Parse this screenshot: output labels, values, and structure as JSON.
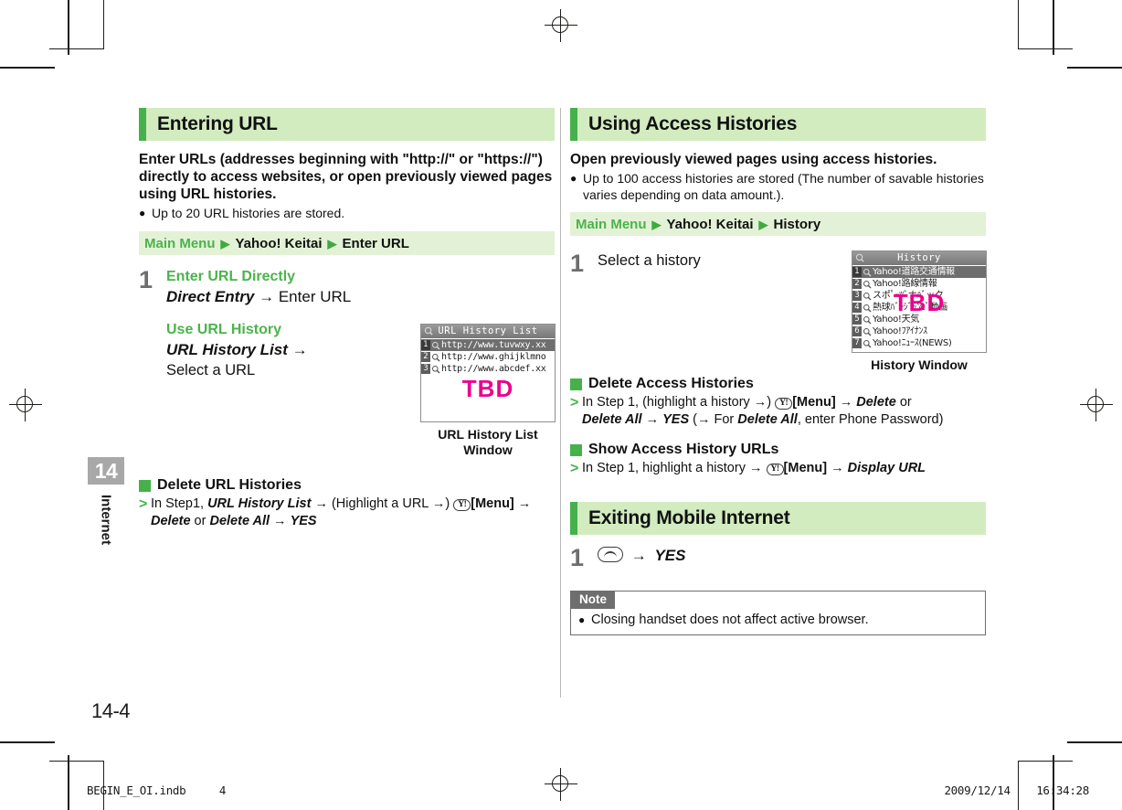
{
  "page": {
    "number": "14-4",
    "chapter_number": "14",
    "chapter_name": "Internet"
  },
  "footer": {
    "file": "BEGIN_E_OI.indb",
    "sheet": "4",
    "date": "2009/12/14",
    "time": "16:34:28"
  },
  "colors": {
    "accent_green": "#46b14b",
    "head_bg": "#d2ecc0",
    "path_bg": "#e3f2d6",
    "tbd_magenta": "#ec008c",
    "gray": "#6e6e6e"
  },
  "left": {
    "section": {
      "title": "Entering URL"
    },
    "intro": "Enter URLs (addresses beginning with \"http://\" or \"https://\") directly to access websites, or open previously viewed pages using URL histories.",
    "bullet": "Up to 20 URL histories are stored.",
    "menu_path": {
      "root": "Main Menu",
      "items": [
        "Yahoo! Keitai",
        "Enter URL"
      ],
      "arrow": "▶"
    },
    "step": {
      "number": "1",
      "block1": {
        "heading": "Enter URL Directly",
        "action_bold": "Direct Entry",
        "arrow": "→",
        "action_rest": "Enter URL"
      },
      "block2": {
        "heading": "Use URL History",
        "action_bold": "URL History List",
        "arrow": "→",
        "action_rest": "Select a URL"
      }
    },
    "screenshot": {
      "title": "URL History List",
      "caption": "URL History List Window",
      "tbd": "TBD",
      "rows": [
        {
          "index": "1",
          "label": "http://www.tuvwxy.xx",
          "selected": true
        },
        {
          "index": "2",
          "label": "http://www.ghijklmno",
          "selected": false
        },
        {
          "index": "3",
          "label": "http://www.abcdef.xx",
          "selected": false
        }
      ]
    },
    "subsection": {
      "heading": "Delete URL Histories",
      "marker": ">",
      "line1_pre": "In Step1, ",
      "line1_bi1": "URL History List",
      "line1_mid": " → (Highlight a URL →) ",
      "key_label": "Y!",
      "line1_menu": "[Menu]",
      "line1_post": " →",
      "line2_bi1": "Delete",
      "line2_or": " or ",
      "line2_bi2": "Delete All",
      "line2_arrow": " → ",
      "line2_bi3": "YES"
    }
  },
  "right": {
    "section": {
      "title": "Using Access Histories"
    },
    "intro": "Open previously viewed pages using access histories.",
    "bullet": "Up to 100 access histories are stored (The number of savable histories varies depending on data amount.).",
    "menu_path": {
      "root": "Main Menu",
      "items": [
        "Yahoo! Keitai",
        "History"
      ],
      "arrow": "▶"
    },
    "step": {
      "number": "1",
      "text": "Select a history"
    },
    "screenshot": {
      "title": "History",
      "caption": "History Window",
      "tbd": "TBD",
      "rows": [
        {
          "index": "1",
          "label": "Yahoo!道路交通情報",
          "selected": true
        },
        {
          "index": "2",
          "label": "Yahoo!路線情報",
          "selected": false
        },
        {
          "index": "3",
          "label": "スポﾟｰﾂﾞナﾊﾞック",
          "selected": false
        },
        {
          "index": "4",
          "label": "熱球ﾊﾞｰｼﾞｯﾝﾋﾟ動画",
          "selected": false
        },
        {
          "index": "5",
          "label": "Yahoo!天気",
          "selected": false
        },
        {
          "index": "6",
          "label": "Yahoo!ﾌｱｲﾅﾝｽ",
          "selected": false
        },
        {
          "index": "7",
          "label": "Yahoo!ﾆｭｰｽ(NEWS)",
          "selected": false
        }
      ]
    },
    "sub_delete": {
      "heading": "Delete Access Histories",
      "marker": ">",
      "line1_pre": "In Step 1, (highlight a history →) ",
      "key_label": "Y!",
      "line1_menu": "[Menu]",
      "line1_arrow": " → ",
      "line1_bi": "Delete",
      "line1_or": " or",
      "line2_bi1": "Delete All",
      "line2_arrow": " → ",
      "line2_bi2": "YES",
      "line2_paren_open": " (→ For ",
      "line2_bi3": "Delete All",
      "line2_paren_close": ", enter Phone Password)"
    },
    "sub_show": {
      "heading": "Show Access History URLs",
      "marker": ">",
      "line1_pre": "In Step 1, highlight a history → ",
      "key_label": "Y!",
      "line1_menu": "[Menu]",
      "line1_arrow": " → ",
      "line1_bi": "Display URL"
    },
    "exit_section": {
      "title": "Exiting Mobile Internet"
    },
    "exit_step": {
      "number": "1",
      "arrow": "→",
      "action": "YES"
    },
    "note": {
      "tag": "Note",
      "text": "Closing handset does not affect active browser."
    }
  }
}
